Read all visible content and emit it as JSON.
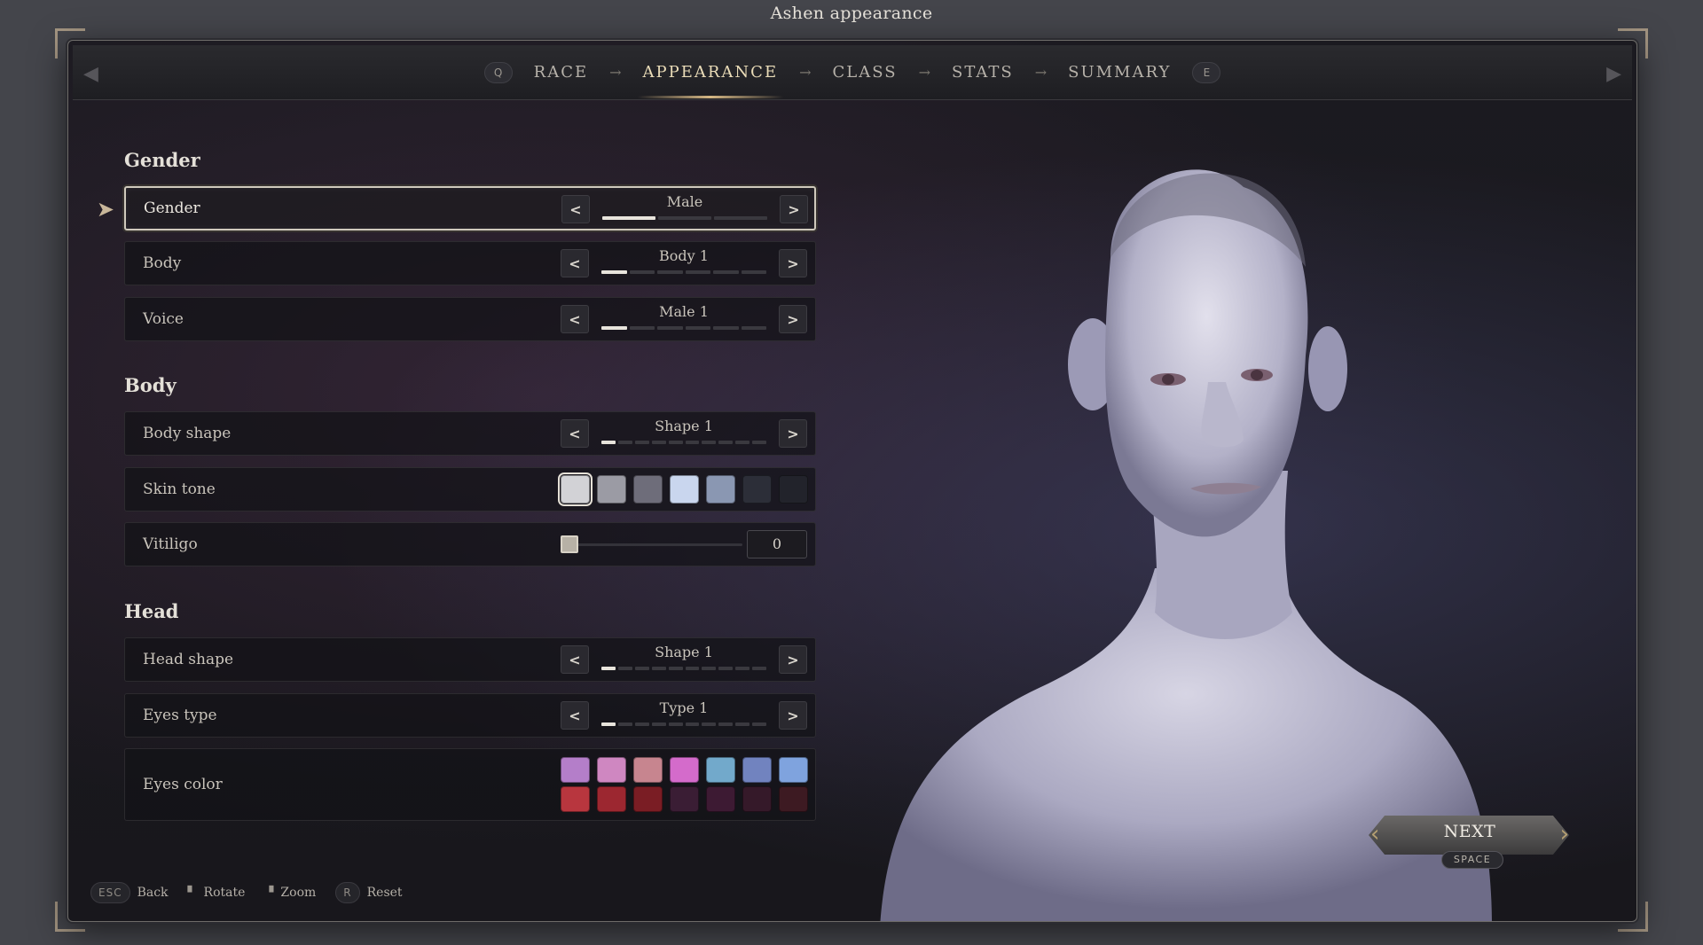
{
  "window_title": "Ashen appearance",
  "nav": {
    "prev_key": "Q",
    "next_key": "E",
    "steps": [
      "RACE",
      "APPEARANCE",
      "CLASS",
      "STATS",
      "SUMMARY"
    ],
    "active_step": "APPEARANCE",
    "arrow": "→"
  },
  "sections": {
    "gender_title": "Gender",
    "body_title": "Body",
    "head_title": "Head"
  },
  "options": {
    "gender": {
      "label": "Gender",
      "value": "Male",
      "index": 1,
      "count": 3
    },
    "body": {
      "label": "Body",
      "value": "Body 1",
      "index": 1,
      "count": 6
    },
    "voice": {
      "label": "Voice",
      "value": "Male 1",
      "index": 1,
      "count": 6
    },
    "body_shape": {
      "label": "Body shape",
      "value": "Shape 1",
      "index": 1,
      "count": 10
    },
    "skin_tone": {
      "label": "Skin tone",
      "selected_index": 0,
      "colors": [
        "#d2d2d6",
        "#9b9ba4",
        "#6e6d7a",
        "#c9d6ee",
        "#8a97b2",
        "#2c2e38",
        "#22232b"
      ]
    },
    "vitiligo": {
      "label": "Vitiligo",
      "value": "0",
      "level": 0
    },
    "head_shape": {
      "label": "Head shape",
      "value": "Shape 1",
      "index": 1,
      "count": 10
    },
    "eyes_type": {
      "label": "Eyes type",
      "value": "Type 1",
      "index": 1,
      "count": 10
    },
    "eyes_color": {
      "label": "Eyes color",
      "colors": [
        "#b47ec9",
        "#cf87c1",
        "#c7858f",
        "#d46bcb",
        "#72a9cb",
        "#7183bf",
        "#7fa3de",
        "#b8363e",
        "#9c2730",
        "#7a1d24",
        "#3a1d34",
        "#3d1a33",
        "#351929",
        "#3d1a22"
      ]
    }
  },
  "hints": {
    "esc_key": "ESC",
    "back": "Back",
    "rotate_icon": "mouse-icon",
    "rotate": "Rotate",
    "zoom_icon": "mouse-icon",
    "zoom": "Zoom",
    "r_key": "R",
    "reset": "Reset"
  },
  "next_button": {
    "label": "NEXT",
    "key": "SPACE"
  }
}
